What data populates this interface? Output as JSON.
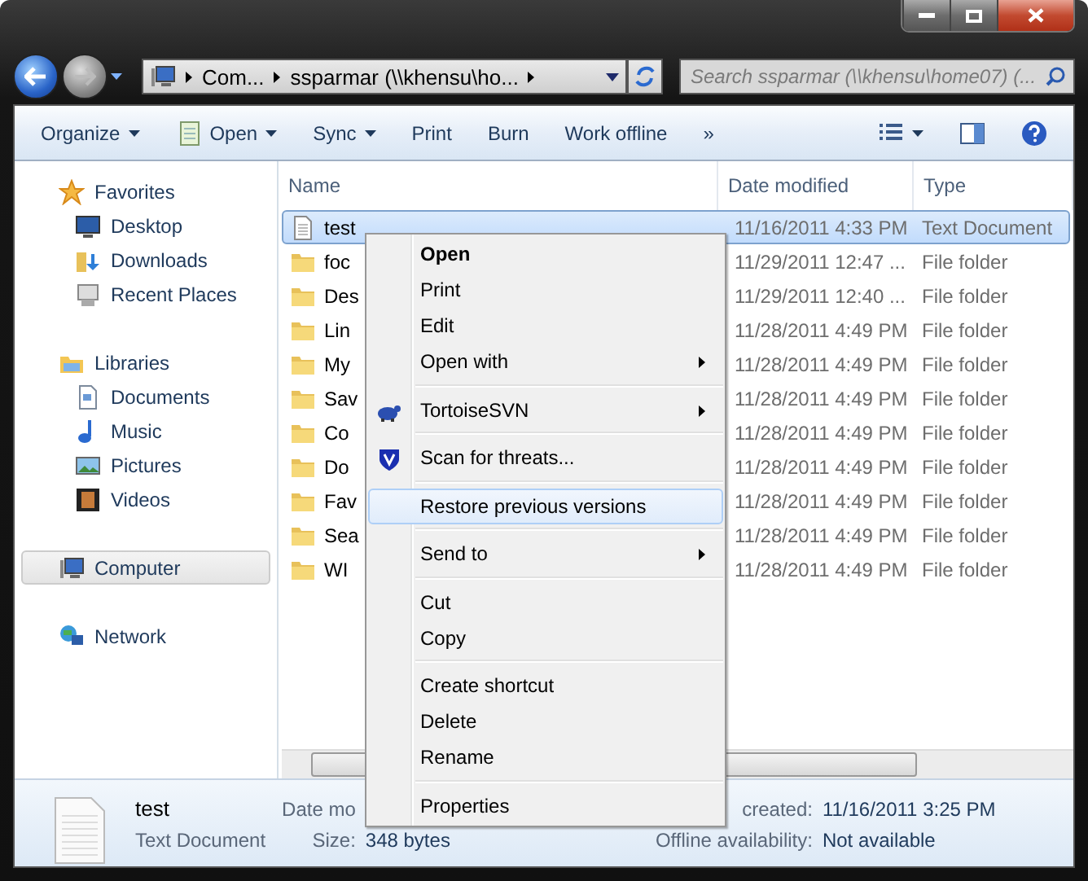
{
  "address": {
    "crumbs": [
      "Com...",
      "ssparmar (\\\\khensu\\ho..."
    ]
  },
  "search": {
    "placeholder": "Search ssparmar (\\\\khensu\\home07) (..."
  },
  "toolbar": [
    {
      "label": "Organize",
      "dropdown": true
    },
    {
      "label": "Open",
      "dropdown": true
    },
    {
      "label": "Sync",
      "dropdown": true
    },
    {
      "label": "Print",
      "dropdown": false
    },
    {
      "label": "Burn",
      "dropdown": false
    },
    {
      "label": "Work offline",
      "dropdown": false
    },
    {
      "label": "»",
      "dropdown": false
    }
  ],
  "sidebar": [
    {
      "label": "Favorites",
      "selected": false,
      "children": [
        {
          "label": "Desktop",
          "selected": false
        },
        {
          "label": "Downloads",
          "selected": false
        },
        {
          "label": "Recent Places",
          "selected": false
        }
      ]
    },
    {
      "label": "Libraries",
      "selected": false,
      "children": [
        {
          "label": "Documents",
          "selected": false
        },
        {
          "label": "Music",
          "selected": false
        },
        {
          "label": "Pictures",
          "selected": false
        },
        {
          "label": "Videos",
          "selected": false
        }
      ]
    },
    {
      "label": "Computer",
      "selected": true
    },
    {
      "label": "Network",
      "selected": false
    }
  ],
  "columns": [
    "Name",
    "Date modified",
    "Type"
  ],
  "files": [
    {
      "name": "test",
      "date": "11/16/2011 4:33 PM",
      "type": "Text Document",
      "kind": "text",
      "selected": true
    },
    {
      "name": "foc",
      "date": "11/29/2011 12:47 ...",
      "type": "File folder",
      "kind": "folder",
      "selected": false
    },
    {
      "name": "Des",
      "date": "11/29/2011 12:40 ...",
      "type": "File folder",
      "kind": "folder",
      "selected": false
    },
    {
      "name": "Lin",
      "date": "11/28/2011 4:49 PM",
      "type": "File folder",
      "kind": "folder",
      "selected": false
    },
    {
      "name": "My",
      "date": "11/28/2011 4:49 PM",
      "type": "File folder",
      "kind": "folder",
      "selected": false
    },
    {
      "name": "Sav",
      "date": "11/28/2011 4:49 PM",
      "type": "File folder",
      "kind": "folder",
      "selected": false
    },
    {
      "name": "Co",
      "date": "11/28/2011 4:49 PM",
      "type": "File folder",
      "kind": "folder",
      "selected": false
    },
    {
      "name": "Do",
      "date": "11/28/2011 4:49 PM",
      "type": "File folder",
      "kind": "folder",
      "selected": false
    },
    {
      "name": "Fav",
      "date": "11/28/2011 4:49 PM",
      "type": "File folder",
      "kind": "folder",
      "selected": false
    },
    {
      "name": "Sea",
      "date": "11/28/2011 4:49 PM",
      "type": "File folder",
      "kind": "folder",
      "selected": false
    },
    {
      "name": "WI",
      "date": "11/28/2011 4:49 PM",
      "type": "File folder",
      "kind": "folder",
      "selected": false
    }
  ],
  "context_menu": [
    {
      "kind": "item",
      "label": "Open",
      "bold": true,
      "submenu": false,
      "selected": false
    },
    {
      "kind": "item",
      "label": "Print",
      "bold": false,
      "submenu": false,
      "selected": false
    },
    {
      "kind": "item",
      "label": "Edit",
      "bold": false,
      "submenu": false,
      "selected": false
    },
    {
      "kind": "item",
      "label": "Open with",
      "bold": false,
      "submenu": true,
      "selected": false
    },
    {
      "kind": "separator"
    },
    {
      "kind": "item",
      "label": "TortoiseSVN",
      "bold": false,
      "submenu": true,
      "selected": false
    },
    {
      "kind": "separator"
    },
    {
      "kind": "item",
      "label": "Scan for threats...",
      "bold": false,
      "submenu": false,
      "selected": false
    },
    {
      "kind": "separator"
    },
    {
      "kind": "item",
      "label": "Restore previous versions",
      "bold": false,
      "submenu": false,
      "selected": true
    },
    {
      "kind": "separator"
    },
    {
      "kind": "item",
      "label": "Send to",
      "bold": false,
      "submenu": true,
      "selected": false
    },
    {
      "kind": "separator"
    },
    {
      "kind": "item",
      "label": "Cut",
      "bold": false,
      "submenu": false,
      "selected": false
    },
    {
      "kind": "item",
      "label": "Copy",
      "bold": false,
      "submenu": false,
      "selected": false
    },
    {
      "kind": "separator"
    },
    {
      "kind": "item",
      "label": "Create shortcut",
      "bold": false,
      "submenu": false,
      "selected": false
    },
    {
      "kind": "item",
      "label": "Delete",
      "bold": false,
      "submenu": false,
      "selected": false
    },
    {
      "kind": "item",
      "label": "Rename",
      "bold": false,
      "submenu": false,
      "selected": false
    },
    {
      "kind": "separator"
    },
    {
      "kind": "item",
      "label": "Properties",
      "bold": false,
      "submenu": false,
      "selected": false
    }
  ],
  "details": {
    "name": "test",
    "type": "Text Document",
    "groups": [
      [
        {
          "label": "Date mo"
        },
        {
          "label": "Size:",
          "value": "348 bytes"
        }
      ],
      [
        {
          "label": "created:",
          "value": "11/16/2011 3:25 PM"
        },
        {
          "label": "Offline availability:",
          "value": "Not available"
        }
      ]
    ]
  }
}
